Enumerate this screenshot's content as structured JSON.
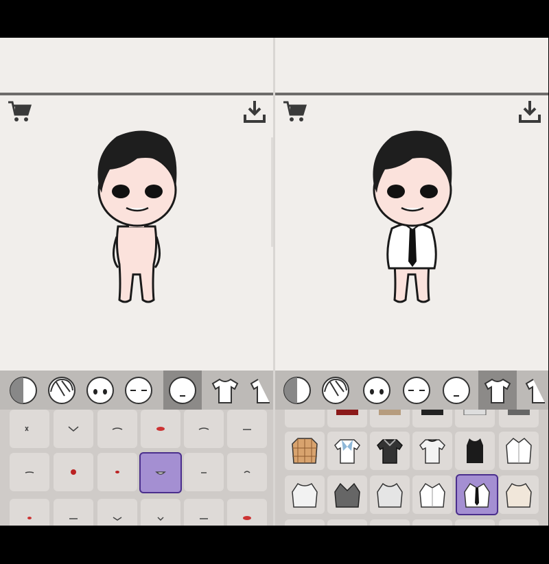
{
  "colors": {
    "panel_bg": "#f1eeeb",
    "category_bar": "#bdbab7",
    "category_active": "#8c8a88",
    "grid_bg": "#cfcbc8",
    "tile_bg": "#dedad7",
    "tile_selected": "#a48fd2",
    "tile_selected_border": "#4a2e8c",
    "top_line": "#6d6b6a"
  },
  "panels": [
    {
      "id": "left",
      "avatar_outfit": "none",
      "active_category_index": 4,
      "selected_tile_index": 9,
      "categories": [
        "color-split-icon",
        "hair-icon",
        "face-eyes-icon",
        "face-sleepy-icon",
        "face-mouth-icon",
        "shirt-icon",
        "more-icon"
      ],
      "tile_kind": "mouth"
    },
    {
      "id": "right",
      "avatar_outfit": "white-shirt-black-tie",
      "active_category_index": 5,
      "selected_tile_index": 10,
      "categories": [
        "color-split-icon",
        "hair-icon",
        "face-eyes-icon",
        "face-sleepy-icon",
        "face-mouth-icon",
        "shirt-icon",
        "more-icon"
      ],
      "tile_kind": "clothing"
    }
  ],
  "toolbar": {
    "cart_icon": "cart-icon",
    "download_icon": "download-icon"
  }
}
